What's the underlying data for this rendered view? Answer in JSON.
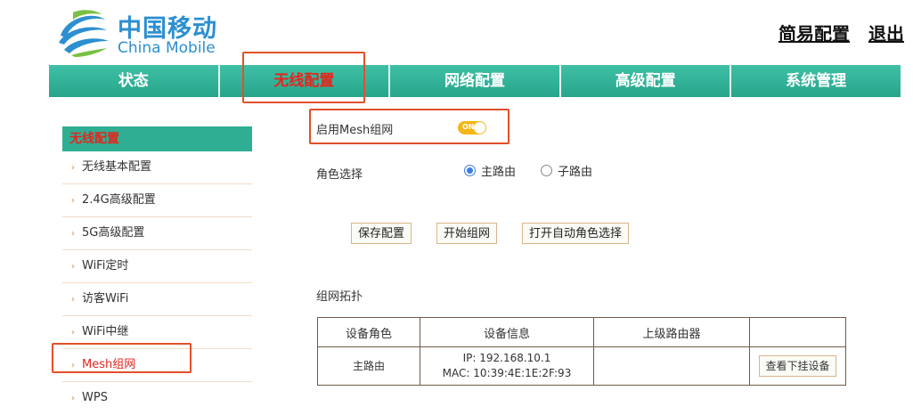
{
  "header": {
    "logo_cn": "中国移动",
    "logo_en": "China Mobile",
    "brand_color": "#2d8fd0",
    "links": [
      "简易配置",
      "退出"
    ]
  },
  "nav": {
    "tabs": [
      "状态",
      "无线配置",
      "网络配置",
      "高级配置",
      "系统管理"
    ],
    "active_tab": "无线配置",
    "bar_color": "#2fae93",
    "active_color": "#e3261d"
  },
  "sidebar": {
    "title": "无线配置",
    "items": [
      "无线基本配置",
      "2.4G高级配置",
      "5G高级配置",
      "WiFi定时",
      "访客WiFi",
      "WiFi中继",
      "Mesh组网",
      "WPS"
    ],
    "active_item": "Mesh组网"
  },
  "mesh": {
    "enable_label": "启用Mesh组网",
    "toggle_text": "ON",
    "toggle_state": "on",
    "toggle_color": "#f3b619"
  },
  "role": {
    "label": "角色选择",
    "options": [
      "主路由",
      "子路由"
    ],
    "selected": "主路由"
  },
  "buttons": {
    "save": "保存配置",
    "start": "开始组网",
    "auto_role": "打开自动角色选择"
  },
  "topology": {
    "label": "组网拓扑",
    "headers": [
      "设备角色",
      "设备信息",
      "上级路由器",
      ""
    ],
    "rows": [
      {
        "role": "主路由",
        "ip": "IP: 192.168.10.1",
        "mac": "MAC: 10:39:4E:1E:2F:93",
        "upper": "",
        "action": "查看下挂设备"
      }
    ]
  }
}
